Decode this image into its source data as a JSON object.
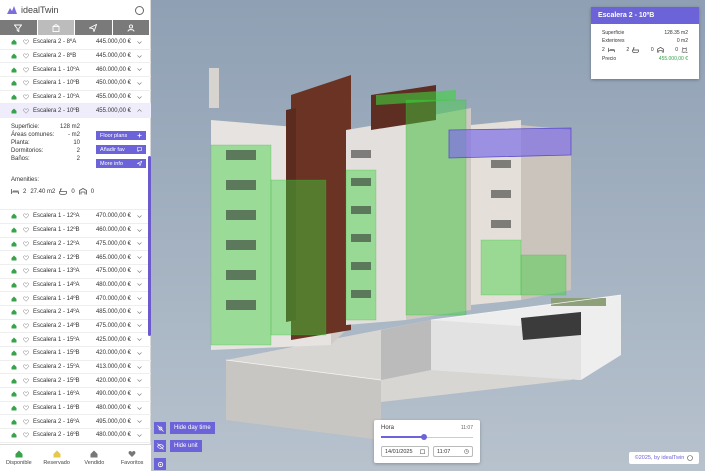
{
  "app": {
    "name": "idealTwin"
  },
  "tabs": [
    {
      "icon": "filter-icon",
      "active": false
    },
    {
      "icon": "building-icon",
      "active": true
    },
    {
      "icon": "send-icon",
      "active": false
    },
    {
      "icon": "user-icon",
      "active": false
    }
  ],
  "units_before": [
    {
      "name": "Escalera 2 - 8ºA",
      "price": "445.000,00 €",
      "status": "disponible"
    },
    {
      "name": "Escalera 2 - 8ºB",
      "price": "445.000,00 €",
      "status": "disponible"
    },
    {
      "name": "Escalera 1 - 10ºA",
      "price": "460.000,00 €",
      "status": "disponible"
    },
    {
      "name": "Escalera 1 - 10ºB",
      "price": "450.000,00 €",
      "status": "disponible"
    },
    {
      "name": "Escalera 2 - 10ºA",
      "price": "455.000,00 €",
      "status": "disponible"
    },
    {
      "name": "Escalera 2 - 10ºB",
      "price": "455.000,00 €",
      "status": "disponible",
      "selected": true
    }
  ],
  "details": {
    "specs": [
      {
        "label": "Superficie:",
        "value": "128 m2"
      },
      {
        "label": "Áreas comunes:",
        "value": "- m2"
      },
      {
        "label": "Planta:",
        "value": "10"
      },
      {
        "label": "Dormitorios:",
        "value": "2"
      },
      {
        "label": "Baños:",
        "value": "2"
      }
    ],
    "amenities_label": "Amenities:",
    "amenities": {
      "rooms": "2",
      "area": "27.40 m2",
      "baths": "0",
      "garage": "0"
    },
    "buttons": {
      "floor_plans": "Floor plans",
      "add_fav": "Añadir fav",
      "more_info": "More info"
    }
  },
  "units_after": [
    {
      "name": "Escalera 1 - 12ºA",
      "price": "470.000,00 €",
      "status": "disponible"
    },
    {
      "name": "Escalera 1 - 12ºB",
      "price": "460.000,00 €",
      "status": "disponible"
    },
    {
      "name": "Escalera 2 - 12ºA",
      "price": "475.000,00 €",
      "status": "disponible"
    },
    {
      "name": "Escalera 2 - 12ºB",
      "price": "465.000,00 €",
      "status": "disponible"
    },
    {
      "name": "Escalera 1 - 13ºA",
      "price": "475.000,00 €",
      "status": "disponible"
    },
    {
      "name": "Escalera 1 - 14ºA",
      "price": "480.000,00 €",
      "status": "disponible"
    },
    {
      "name": "Escalera 1 - 14ºB",
      "price": "470.000,00 €",
      "status": "disponible"
    },
    {
      "name": "Escalera 2 - 14ºA",
      "price": "485.000,00 €",
      "status": "disponible"
    },
    {
      "name": "Escalera 2 - 14ºB",
      "price": "475.000,00 €",
      "status": "disponible"
    },
    {
      "name": "Escalera 1 - 15ºA",
      "price": "425.000,00 €",
      "status": "disponible"
    },
    {
      "name": "Escalera 1 - 15ºB",
      "price": "420.000,00 €",
      "status": "disponible"
    },
    {
      "name": "Escalera 2 - 15ºA",
      "price": "413.000,00 €",
      "status": "disponible"
    },
    {
      "name": "Escalera 2 - 15ºB",
      "price": "420.000,00 €",
      "status": "disponible"
    },
    {
      "name": "Escalera 1 - 16ºA",
      "price": "490.000,00 €",
      "status": "disponible"
    },
    {
      "name": "Escalera 1 - 16ºB",
      "price": "480.000,00 €",
      "status": "disponible"
    },
    {
      "name": "Escalera 2 - 16ºA",
      "price": "495.000,00 €",
      "status": "disponible"
    },
    {
      "name": "Escalera 2 - 16ºB",
      "price": "480.000,00 €",
      "status": "disponible"
    }
  ],
  "status_bar": [
    {
      "label": "Disponible",
      "icon": "home-icon",
      "color": "#3aa24a"
    },
    {
      "label": "Reservado",
      "icon": "home-icon",
      "color": "#e6c84a"
    },
    {
      "label": "Vendido",
      "icon": "home-icon",
      "color": "#777777"
    },
    {
      "label": "Favoritos",
      "icon": "heart-icon",
      "color": "#777777"
    }
  ],
  "info_card": {
    "title": "Escalera 2 - 10ºB",
    "lines": [
      {
        "label": "Superficie",
        "value": "128.35 m2"
      },
      {
        "label": "Exteriores",
        "value": "0 m2"
      }
    ],
    "amenities": {
      "rooms": "2",
      "baths": "2",
      "garage": "0",
      "pool": "0"
    },
    "price_label": "Precio",
    "price": "455.000,00 €"
  },
  "controls": {
    "hide_day_time": "Hide day time",
    "hide_unit": "Hide unit"
  },
  "time_panel": {
    "label": "Hora",
    "time_value": "11:07",
    "slider_fraction": 0.47,
    "date": "14/01/2025",
    "time": "11:07"
  },
  "credit": "©2025, by idealTwin",
  "colors": {
    "accent": "#6c63d8",
    "available": "#3aa24a",
    "reserved": "#e6c84a"
  }
}
